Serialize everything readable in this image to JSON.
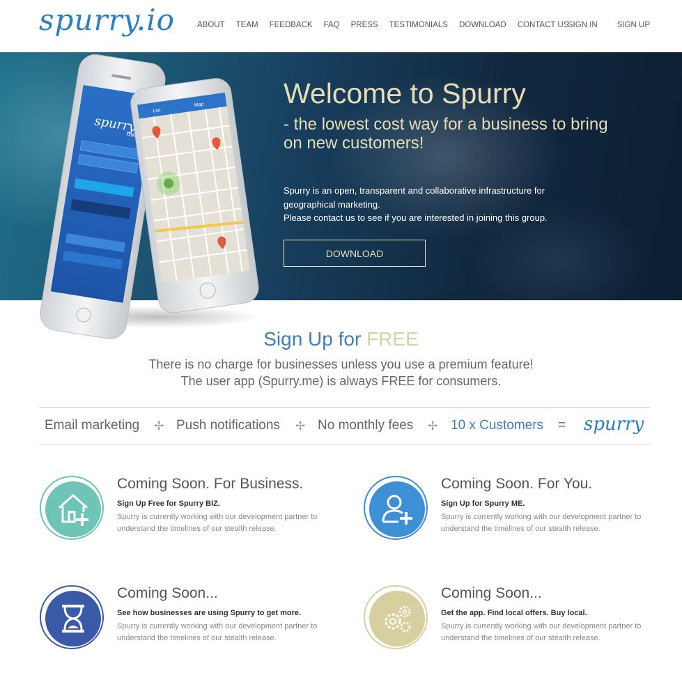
{
  "header": {
    "logo": "spurry.io",
    "nav": [
      "ABOUT",
      "TEAM",
      "FEEDBACK",
      "FAQ",
      "PRESS",
      "TESTIMONIALS",
      "DOWNLOAD",
      "CONTACT US"
    ],
    "sign_in": "SIGN IN",
    "sign_up": "SIGN UP"
  },
  "hero": {
    "title": "Welcome to Spurry",
    "subtitle": "- the lowest cost way for a business to bring on new customers!",
    "desc_line1": "Spurry is an open, transparent and collaborative infrastructure for geographical marketing.",
    "desc_line2": "Please contact us to see if you are interested in joining this group.",
    "button": "DOWNLOAD",
    "phone_app_name": "spurry",
    "phone_app_suffix": "me",
    "map_tab_list": "List",
    "map_tab_map": "Map"
  },
  "signup": {
    "title_part1": "Sign Up for ",
    "title_part2": "FREE",
    "line1": "There is no charge for businesses unless you use a premium feature!",
    "line2": "The user app (Spurry.me) is always FREE for consumers."
  },
  "formula": {
    "item1": "Email marketing",
    "item2": "Push notifications",
    "item3": "No monthly fees",
    "item4": "10 x Customers",
    "plus": "✢",
    "equals": "=",
    "logo": "spurry"
  },
  "features": [
    {
      "title": "Coming Soon. For Business.",
      "strong": "Sign Up Free for Spurry BIZ.",
      "desc": "Spurry is currently working with our development partner to understand the timelines of our stealth release.",
      "icon": "house-plus-icon",
      "color": "#6ec4b6"
    },
    {
      "title": "Coming Soon. For You.",
      "strong": "Sign Up for Spurry ME.",
      "desc": "Spurry is currently working with our development partner to understand the timelines of our stealth release.",
      "icon": "user-plus-icon",
      "color": "#3d8fd6"
    },
    {
      "title": "Coming Soon...",
      "strong": "See how businesses are using Spurry to get more.",
      "desc": "Spurry is currently working with our development partner to understand the timelines of our stealth release.",
      "icon": "hourglass-icon",
      "color": "#3a5aa8"
    },
    {
      "title": "Coming Soon...",
      "strong": "Get the app. Find local offers. Buy local.",
      "desc": "Spurry is currently working with our development partner to understand the timelines of our stealth release.",
      "icon": "gears-icon",
      "color": "#d8cfa0"
    }
  ],
  "colors": {
    "brand_blue": "#2a7fc2",
    "hero_text": "#e6ddb7",
    "free_gold": "#d9d1a6"
  }
}
